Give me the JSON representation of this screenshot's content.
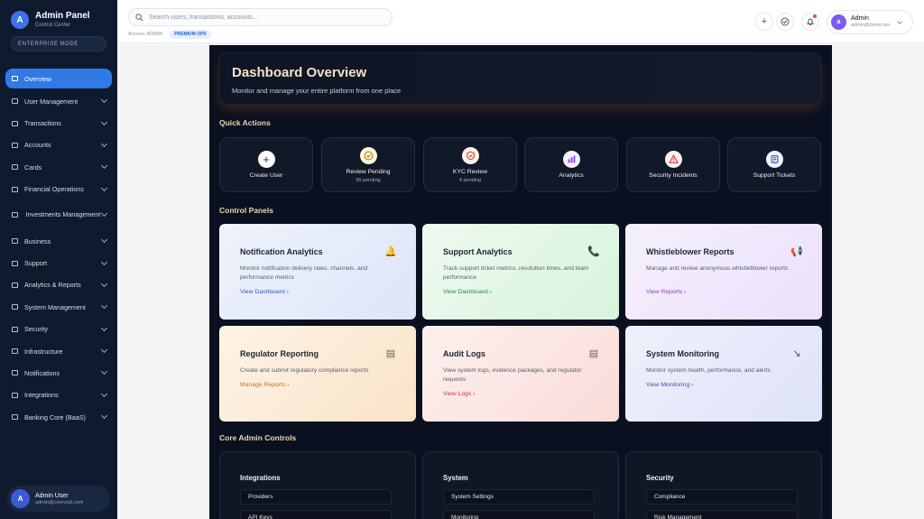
{
  "sidebar": {
    "brand_initial": "A",
    "title": "Admin Panel",
    "subtitle": "Control Center",
    "mode": "ENTERPRISE MODE",
    "items": [
      {
        "label": "Overview",
        "icon": "chart-icon"
      },
      {
        "label": "User Management",
        "icon": "users-icon"
      },
      {
        "label": "Transactions",
        "icon": "exchange-icon"
      },
      {
        "label": "Accounts",
        "icon": "bank-icon"
      },
      {
        "label": "Cards",
        "icon": "card-icon"
      },
      {
        "label": "Financial Operations",
        "icon": "finance-icon"
      },
      {
        "label": "Investments Management",
        "icon": "investment-icon"
      },
      {
        "label": "Business",
        "icon": "briefcase-icon"
      },
      {
        "label": "Support",
        "icon": "headset-icon"
      },
      {
        "label": "Analytics & Reports",
        "icon": "analytics-icon"
      },
      {
        "label": "System Management",
        "icon": "settings-icon"
      },
      {
        "label": "Security",
        "icon": "shield-icon"
      },
      {
        "label": "Infrastructure",
        "icon": "server-icon"
      },
      {
        "label": "Notifications",
        "icon": "bell-icon"
      },
      {
        "label": "Integrations",
        "icon": "plug-icon"
      },
      {
        "label": "Banking Core (BaaS)",
        "icon": "bank-core-icon"
      }
    ],
    "user": {
      "initial": "A",
      "name": "Admin User",
      "email": "admin@corevold.com"
    }
  },
  "topbar": {
    "search_placeholder": "Search users, transactions, accounts...",
    "access_label": "Access: ADMIN",
    "badge": "PREMIUM OPS",
    "admin": {
      "initial": "a",
      "name": "Admin",
      "email": "admin@demo.sm"
    }
  },
  "hero": {
    "title": "Dashboard Overview",
    "subtitle": "Monitor and manage your entire platform from one place"
  },
  "quick_actions": {
    "title": "Quick Actions",
    "items": [
      {
        "label": "Create User",
        "sub": "",
        "icon": "plus-icon"
      },
      {
        "label": "Review Pending",
        "sub": "56 pending",
        "icon": "check-icon"
      },
      {
        "label": "KYC Review",
        "sub": "4 pending",
        "icon": "shield-check-icon"
      },
      {
        "label": "Analytics",
        "sub": "",
        "icon": "bar-chart-icon"
      },
      {
        "label": "Security Incidents",
        "sub": "",
        "icon": "warning-icon"
      },
      {
        "label": "Support Tickets",
        "sub": "",
        "icon": "ticket-icon"
      }
    ]
  },
  "control_panels": {
    "title": "Control Panels",
    "cards": [
      {
        "title": "Notification Analytics",
        "desc": "Monitor notification delivery rates, channels, and performance metrics",
        "link": "View Dashboard",
        "icon": "bell-icon"
      },
      {
        "title": "Support Analytics",
        "desc": "Track support ticket metrics, resolution times, and team performance",
        "link": "View Dashboard",
        "icon": "phone-icon"
      },
      {
        "title": "Whistleblower Reports",
        "desc": "Manage and review anonymous whistleblower reports",
        "link": "View Reports",
        "icon": "megaphone-icon"
      },
      {
        "title": "Regulator Reporting",
        "desc": "Create and submit regulatory compliance reports",
        "link": "Manage Reports",
        "icon": "document-icon"
      },
      {
        "title": "Audit Logs",
        "desc": "View system logs, evidence packages, and regulator requests",
        "link": "View Logs",
        "icon": "log-icon"
      },
      {
        "title": "System Monitoring",
        "desc": "Monitor system health, performance, and alerts",
        "link": "View Monitoring",
        "icon": "monitor-icon"
      }
    ]
  },
  "core_controls": {
    "title": "Core Admin Controls",
    "groups": [
      {
        "title": "Integrations",
        "items": [
          "Providers",
          "API Keys"
        ]
      },
      {
        "title": "System",
        "items": [
          "System Settings",
          "Monitoring"
        ]
      },
      {
        "title": "Security",
        "items": [
          "Compliance",
          "Risk Management"
        ]
      }
    ]
  },
  "colors": {
    "sidebar_bg": "#0f1a2f",
    "accent": "#2f7ae5",
    "main_bg": "#0b1020",
    "section_title": "#e9d7b2"
  }
}
